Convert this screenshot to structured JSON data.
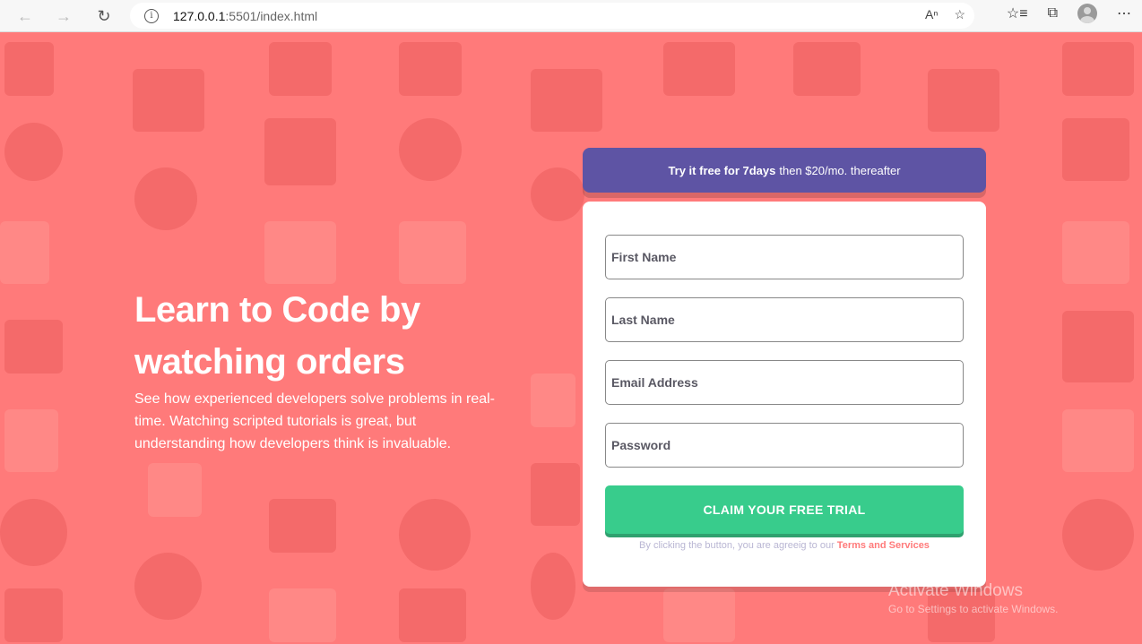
{
  "browser": {
    "url_host": "127.0.0.1",
    "url_rest": ":5501/index.html"
  },
  "hero": {
    "title_line1": "Learn to Code by",
    "title_line2": "watching orders",
    "body": "See how experienced developers solve problems in real-time. Watching scripted tutorials is great, but understanding how developers think is invaluable."
  },
  "promo": {
    "bold": "Try it free for 7days",
    "rest": "then $20/mo. thereafter"
  },
  "form": {
    "first_name_placeholder": "First Name",
    "last_name_placeholder": "Last Name",
    "email_placeholder": "Email Address",
    "password_placeholder": "Password",
    "submit_label": "CLAIM YOUR FREE TRIAL",
    "terms_text": "By clicking the button, you are agreeig to our",
    "terms_link": "Terms and Services"
  },
  "watermark": {
    "line1": "Activate Windows",
    "line2": "Go to Settings to activate Windows."
  },
  "colors": {
    "background": "#ff7a7a",
    "promo": "#5e54a4",
    "cta": "#38cc8c",
    "card": "#ffffff"
  }
}
